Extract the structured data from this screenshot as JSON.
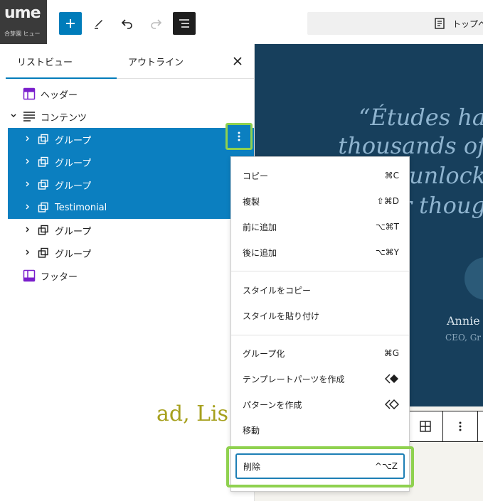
{
  "toolbar": {
    "logo_text": "ume",
    "logo_subtext": "合芽園 ヒュー",
    "doc_title": "トップへ"
  },
  "panel": {
    "tab_list": "リストビュー",
    "tab_outline": "アウトライン",
    "rows": [
      {
        "label": "ヘッダー"
      },
      {
        "label": "コンテンツ"
      },
      {
        "label": "グループ"
      },
      {
        "label": "グループ"
      },
      {
        "label": "グループ"
      },
      {
        "label": "Testimonial"
      },
      {
        "label": "グループ"
      },
      {
        "label": "グループ"
      },
      {
        "label": "フッター"
      }
    ]
  },
  "canvas": {
    "quote_lines": [
      "“Études ha",
      "thousands of",
      "unlock",
      "r thoug"
    ],
    "author": "Annie",
    "role": "CEO, Gr",
    "lower_text": "ad, Lis"
  },
  "menu": {
    "items": [
      {
        "label": "コピー",
        "shortcut": "⌘C"
      },
      {
        "label": "複製",
        "shortcut": "⇧⌘D"
      },
      {
        "label": "前に追加",
        "shortcut": "⌥⌘T"
      },
      {
        "label": "後に追加",
        "shortcut": "⌥⌘Y"
      },
      {
        "label": "スタイルをコピー",
        "shortcut": ""
      },
      {
        "label": "スタイルを貼り付け",
        "shortcut": ""
      },
      {
        "label": "グループ化",
        "shortcut": "⌘G"
      },
      {
        "label": "テンプレートパーツを作成",
        "shortcut": ""
      },
      {
        "label": "パターンを作成",
        "shortcut": ""
      },
      {
        "label": "移動",
        "shortcut": ""
      }
    ],
    "delete": {
      "label": "削除",
      "shortcut": "^⌥Z"
    }
  },
  "colors": {
    "accent": "#007cba",
    "selection": "#0b7fc0",
    "highlight": "#8fd14f",
    "hero": "#173f5c"
  }
}
